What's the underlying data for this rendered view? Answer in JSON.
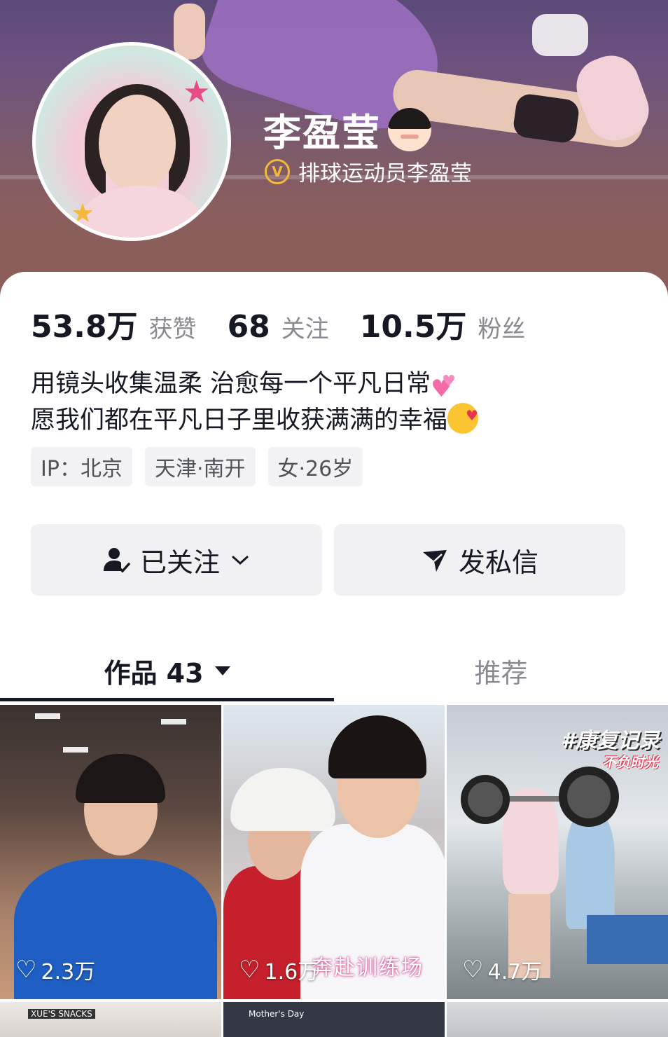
{
  "profile": {
    "name": "李盈莹",
    "verification": "排球运动员李盈莹",
    "verification_badge": "V",
    "accent_color": "#f5b93a"
  },
  "stats": [
    {
      "value": "53.8万",
      "label": "获赞"
    },
    {
      "value": "68",
      "label": "关注"
    },
    {
      "value": "10.5万",
      "label": "粉丝"
    }
  ],
  "bio": {
    "line1": "用镜头收集温柔 治愈每一个平凡日常",
    "line2": "愿我们都在平凡日子里收获满满的幸福"
  },
  "tags": [
    "IP：北京",
    "天津·南开",
    "女·26岁"
  ],
  "actions": {
    "follow_label": "已关注",
    "message_label": "发私信"
  },
  "tabs": {
    "works_label": "作品 43",
    "recommend_label": "推荐"
  },
  "videos": [
    {
      "likes": "2.3万",
      "overlay": ""
    },
    {
      "likes": "1.6万",
      "overlay": "奔赴训练场"
    },
    {
      "likes": "4.7万",
      "overlay": "#康复记录",
      "overlay2": "不负时光"
    }
  ],
  "video_row2": {
    "tile1_text": "XUE'S SNACKS",
    "tile2_text": "Mother's Day"
  }
}
